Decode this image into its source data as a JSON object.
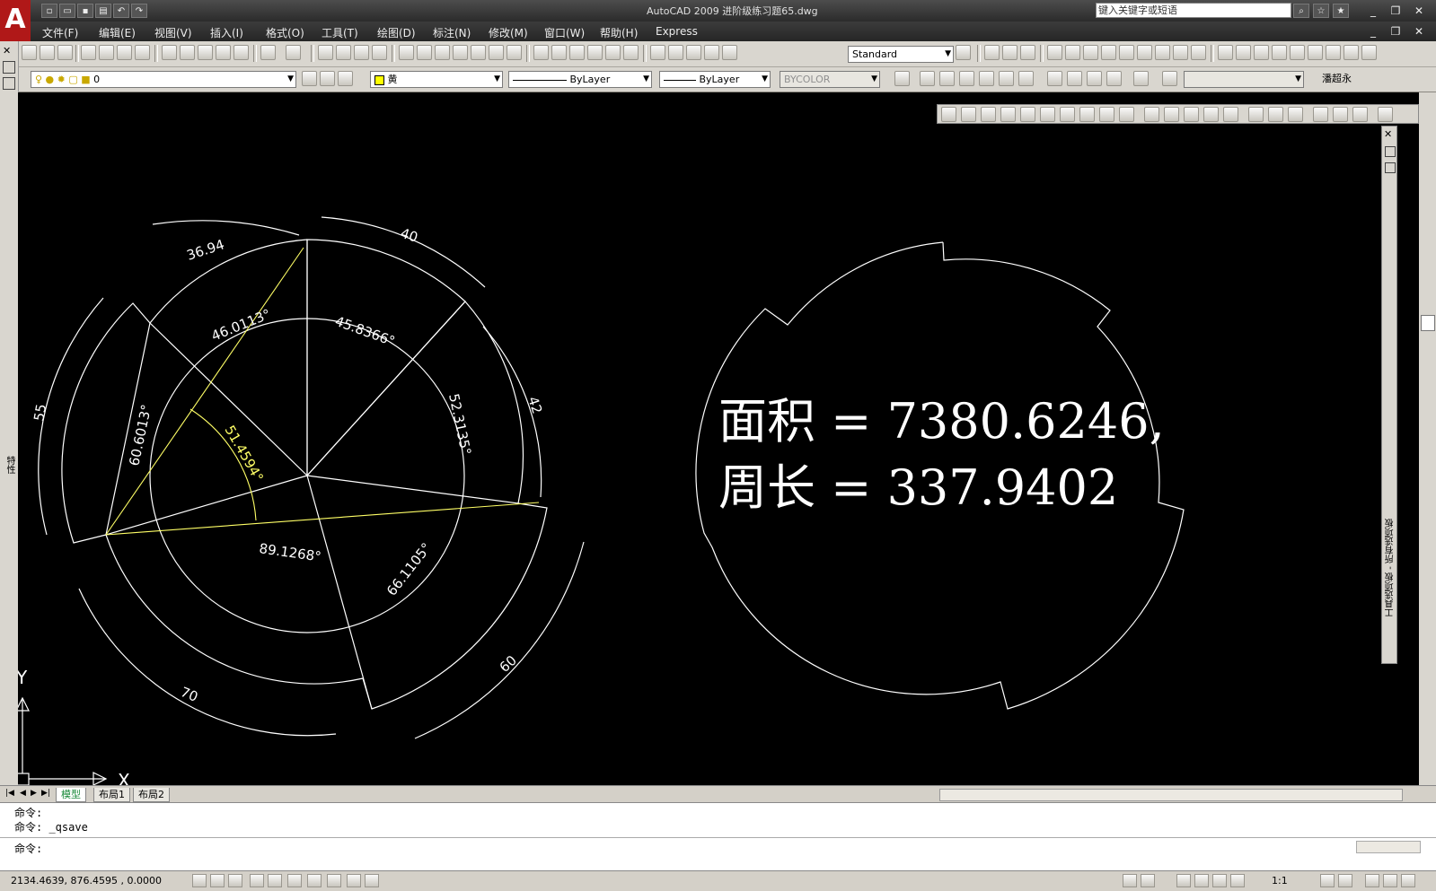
{
  "titlebar": {
    "title": "AutoCAD 2009 进阶级练习题65.dwg",
    "search_placeholder": "键入关键字或短语",
    "logo": "A"
  },
  "menu": [
    "文件(F)",
    "编辑(E)",
    "视图(V)",
    "插入(I)",
    "格式(O)",
    "工具(T)",
    "绘图(D)",
    "标注(N)",
    "修改(M)",
    "窗口(W)",
    "帮助(H)",
    "Express"
  ],
  "toolbar": {
    "text_style": "Standard",
    "layer": "0",
    "color": "黄",
    "linetype": "ByLayer",
    "lineweight": "ByLayer",
    "plotstyle": "BYCOLOR",
    "user": "潘超永"
  },
  "drawing": {
    "area_label": "面积 = 7380.6246,",
    "perimeter_label": "周长 = 337.9402",
    "dims": {
      "r36": "36.94",
      "r40": "40",
      "r42": "42",
      "r55": "55",
      "r60": "60",
      "r70": "70",
      "a1": "46.0113°",
      "a2": "45.8366°",
      "a3": "52.3135°",
      "a4": "60.6013°",
      "a5": "51.4594°",
      "a6": "89.1268°",
      "a7": "66.1105°"
    },
    "ucs_x": "X",
    "ucs_y": "Y"
  },
  "palettes": {
    "right_label": "工具选项板 - 所有选项板",
    "left_label": "特性"
  },
  "tabs": [
    "模型",
    "布局1",
    "布局2"
  ],
  "command": {
    "line1": "命令:",
    "line2": "命令: _qsave",
    "prompt": "命令:"
  },
  "status": {
    "coords": "2134.4639, 876.4595 , 0.0000",
    "scale": "1:1"
  },
  "colors": {
    "canvas": "#000000",
    "geometry": "#ffffff",
    "construction": "#ffff00"
  }
}
